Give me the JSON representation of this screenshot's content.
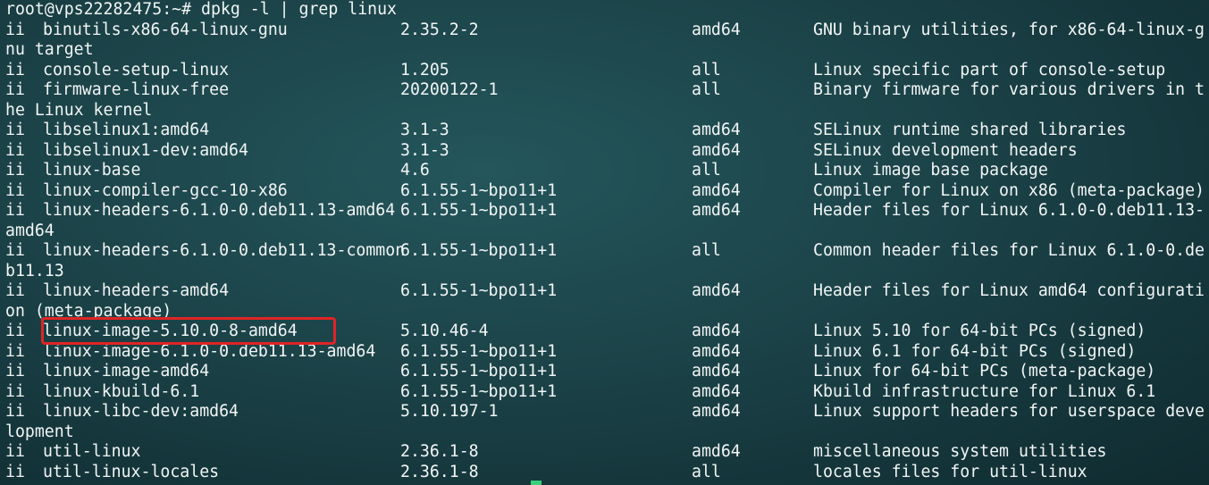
{
  "prompt": "root@vps22282475:~# dpkg -l | grep linux",
  "lines": [
    {
      "state": "ii",
      "name": "binutils-x86-64-linux-gnu",
      "version": "2.35.2-2",
      "arch": "amd64",
      "desc": "GNU binary utilities, for x86-64-linux-g"
    },
    {
      "wrap": "nu target"
    },
    {
      "state": "ii",
      "name": "console-setup-linux",
      "version": "1.205",
      "arch": "all",
      "desc": "Linux specific part of console-setup"
    },
    {
      "state": "ii",
      "name": "firmware-linux-free",
      "version": "20200122-1",
      "arch": "all",
      "desc": "Binary firmware for various drivers in t"
    },
    {
      "wrap": "he Linux kernel"
    },
    {
      "state": "ii",
      "name": "libselinux1:amd64",
      "version": "3.1-3",
      "arch": "amd64",
      "desc": "SELinux runtime shared libraries"
    },
    {
      "state": "ii",
      "name": "libselinux1-dev:amd64",
      "version": "3.1-3",
      "arch": "amd64",
      "desc": "SELinux development headers"
    },
    {
      "state": "ii",
      "name": "linux-base",
      "version": "4.6",
      "arch": "all",
      "desc": "Linux image base package"
    },
    {
      "state": "ii",
      "name": "linux-compiler-gcc-10-x86",
      "version": "6.1.55-1~bpo11+1",
      "arch": "amd64",
      "desc": "Compiler for Linux on x86 (meta-package)"
    },
    {
      "state": "ii",
      "name": "linux-headers-6.1.0-0.deb11.13-amd64",
      "version": "6.1.55-1~bpo11+1",
      "arch": "amd64",
      "desc": "Header files for Linux 6.1.0-0.deb11.13-"
    },
    {
      "wrap": "amd64"
    },
    {
      "state": "ii",
      "name": "linux-headers-6.1.0-0.deb11.13-common",
      "version": "6.1.55-1~bpo11+1",
      "arch": "all",
      "desc": "Common header files for Linux 6.1.0-0.de"
    },
    {
      "wrap": "b11.13"
    },
    {
      "state": "ii",
      "name": "linux-headers-amd64",
      "version": "6.1.55-1~bpo11+1",
      "arch": "amd64",
      "desc": "Header files for Linux amd64 configurati"
    },
    {
      "wrap": "on (meta-package)"
    },
    {
      "state": "ii",
      "name": "linux-image-5.10.0-8-amd64",
      "version": "5.10.46-4",
      "arch": "amd64",
      "desc": "Linux 5.10 for 64-bit PCs (signed)"
    },
    {
      "state": "ii",
      "name": "linux-image-6.1.0-0.deb11.13-amd64",
      "version": "6.1.55-1~bpo11+1",
      "arch": "amd64",
      "desc": "Linux 6.1 for 64-bit PCs (signed)"
    },
    {
      "state": "ii",
      "name": "linux-image-amd64",
      "version": "6.1.55-1~bpo11+1",
      "arch": "amd64",
      "desc": "Linux for 64-bit PCs (meta-package)"
    },
    {
      "state": "ii",
      "name": "linux-kbuild-6.1",
      "version": "6.1.55-1~bpo11+1",
      "arch": "amd64",
      "desc": "Kbuild infrastructure for Linux 6.1"
    },
    {
      "state": "ii",
      "name": "linux-libc-dev:amd64",
      "version": "5.10.197-1",
      "arch": "amd64",
      "desc": "Linux support headers for userspace deve"
    },
    {
      "wrap": "lopment"
    },
    {
      "state": "ii",
      "name": "util-linux",
      "version": "2.36.1-8",
      "arch": "amd64",
      "desc": "miscellaneous system utilities"
    },
    {
      "state": "ii",
      "name": "util-linux-locales",
      "version": "2.36.1-8",
      "arch": "all",
      "desc": "locales files for util-linux"
    }
  ],
  "colors": {
    "text": "#f2f5f5",
    "background": "#1b4348",
    "highlight": "#e02424",
    "cursor": "#39d07a"
  }
}
